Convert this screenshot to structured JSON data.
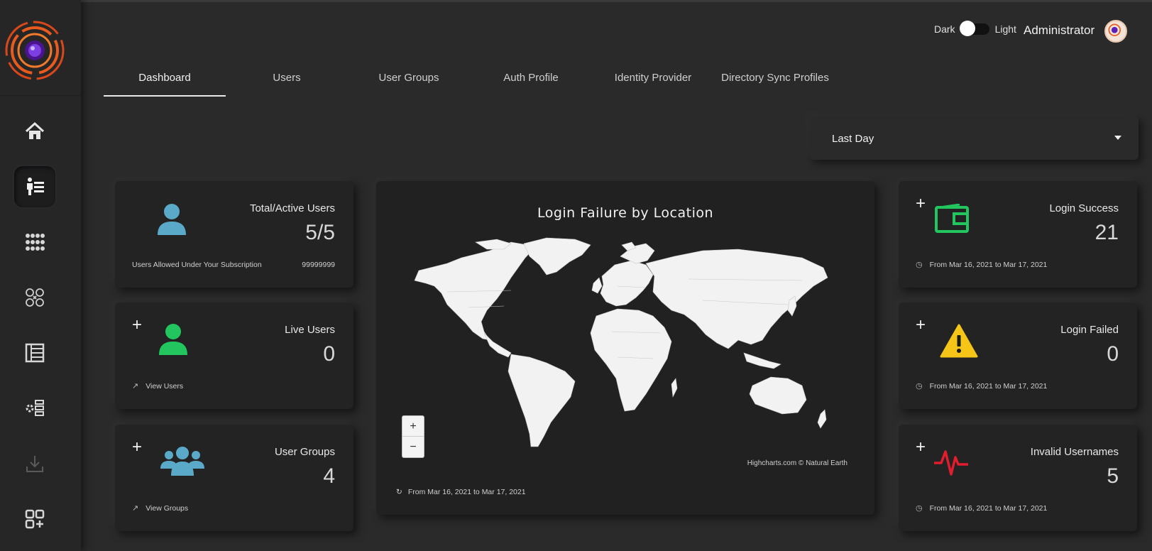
{
  "header": {
    "theme_dark_label": "Dark",
    "theme_light_label": "Light",
    "user_name": "Administrator"
  },
  "tabs": [
    {
      "label": "Dashboard",
      "active": true
    },
    {
      "label": "Users",
      "active": false
    },
    {
      "label": "User Groups",
      "active": false
    },
    {
      "label": "Auth Profile",
      "active": false
    },
    {
      "label": "Identity Provider",
      "active": false
    },
    {
      "label": "Directory Sync Profiles",
      "active": false
    }
  ],
  "sidebar": {
    "items": [
      {
        "icon": "home-icon"
      },
      {
        "icon": "users-list-icon",
        "active": true
      },
      {
        "icon": "apps-grid-icon"
      },
      {
        "icon": "user-groups-icon"
      },
      {
        "icon": "list-icon"
      },
      {
        "icon": "settings-list-icon"
      },
      {
        "icon": "download-icon"
      },
      {
        "icon": "add-widget-icon"
      }
    ]
  },
  "time_filter": {
    "selected": "Last Day"
  },
  "cards": {
    "total_users": {
      "title": "Total/Active Users",
      "value": "5/5",
      "sub_label": "Users Allowed Under Your Subscription",
      "sub_value": "99999999",
      "icon_color": "#5aa9c8"
    },
    "live_users": {
      "title": "Live Users",
      "value": "0",
      "link": "View Users",
      "icon_color": "#22c55e"
    },
    "user_groups": {
      "title": "User Groups",
      "value": "4",
      "link": "View Groups",
      "icon_color": "#5aa9c8"
    },
    "login_success": {
      "title": "Login Success",
      "value": "21",
      "date_range": "From Mar 16, 2021 to Mar 17, 2021",
      "icon_color": "#22c55e"
    },
    "login_failed": {
      "title": "Login Failed",
      "value": "0",
      "date_range": "From Mar 16, 2021 to Mar 17, 2021",
      "icon_color": "#f5c518"
    },
    "invalid_usernames": {
      "title": "Invalid Usernames",
      "value": "5",
      "date_range": "From Mar 16, 2021 to Mar 17, 2021",
      "icon_color": "#e11d2e"
    }
  },
  "map": {
    "title": "Login Failure by Location",
    "zoom_in": "+",
    "zoom_out": "−",
    "credits": "Highcharts.com © Natural Earth",
    "date_range": "From Mar 16, 2021 to Mar 17, 2021"
  }
}
